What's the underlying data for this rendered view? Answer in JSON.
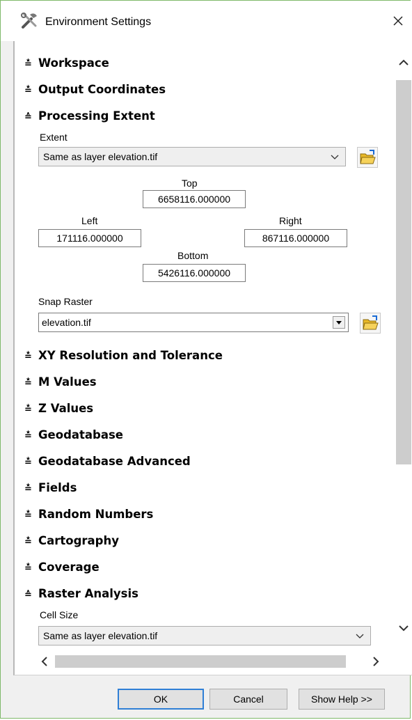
{
  "window": {
    "title": "Environment Settings"
  },
  "sections": {
    "workspace": "Workspace",
    "output_coordinates": "Output Coordinates",
    "processing_extent": "Processing Extent",
    "xy_resolution": "XY Resolution and Tolerance",
    "m_values": "M Values",
    "z_values": "Z Values",
    "geodatabase": "Geodatabase",
    "geodatabase_advanced": "Geodatabase Advanced",
    "fields": "Fields",
    "random_numbers": "Random Numbers",
    "cartography": "Cartography",
    "coverage": "Coverage",
    "raster_analysis": "Raster Analysis"
  },
  "extent": {
    "label": "Extent",
    "value": "Same as layer elevation.tif",
    "top_label": "Top",
    "top_value": "6658116.000000",
    "left_label": "Left",
    "left_value": "171116.000000",
    "right_label": "Right",
    "right_value": "867116.000000",
    "bottom_label": "Bottom",
    "bottom_value": "5426116.000000"
  },
  "snap_raster": {
    "label": "Snap Raster",
    "value": "elevation.tif"
  },
  "cell_size": {
    "label": "Cell Size",
    "value": "Same as layer elevation.tif"
  },
  "buttons": {
    "ok": "OK",
    "cancel": "Cancel",
    "show_help": "Show Help >>"
  },
  "icons": {
    "title": "tools-icon",
    "close": "close-icon",
    "browse": "open-folder-icon",
    "expand": "double-chevron-down-icon",
    "collapse": "double-chevron-up-icon"
  }
}
